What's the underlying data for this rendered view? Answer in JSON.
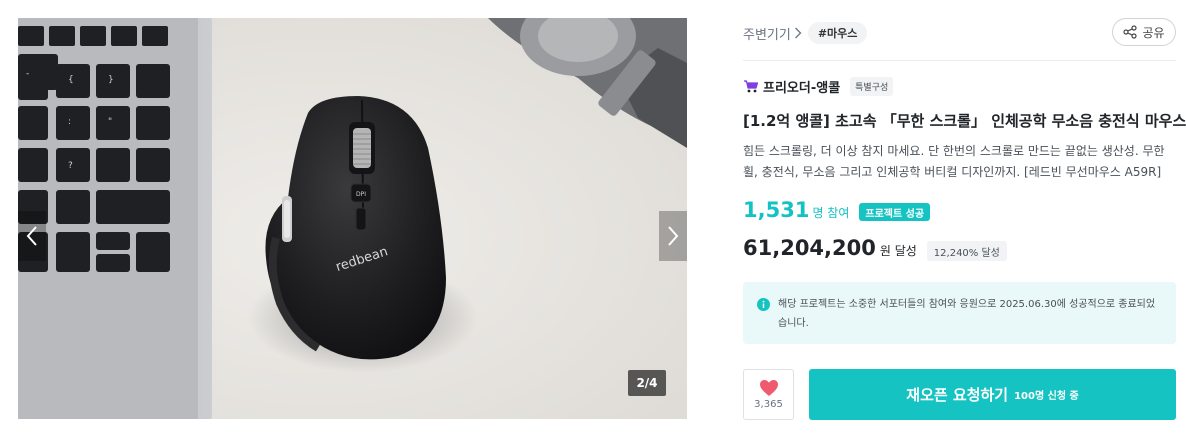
{
  "gallery": {
    "pager": "2/4",
    "brand_print": "redbean"
  },
  "breadcrumb": {
    "category": "주변기기",
    "tag": "#마우스"
  },
  "share": {
    "label": "공유"
  },
  "maker": {
    "name": "프리오더-앵콜",
    "badge": "특별구성"
  },
  "product": {
    "title": "[1.2억 앵콜] 초고속 「무한 스크롤」 인체공학 무소음 충전식 마우스",
    "description": "힘든 스크롤링, 더 이상 참지 마세요. 단 한번의 스크롤로 만드는 끝없는 생산성. 무한휠, 충전식, 무소음 그리고 인체공학 버티컬 디자인까지. [레드빈 무선마우스 A59R]"
  },
  "stats": {
    "participants": "1,531",
    "participants_unit": "명 참여",
    "success_tag": "프로젝트 성공",
    "amount": "61,204,200",
    "amount_unit": "원 달성",
    "rate": "12,240% 달성"
  },
  "notice": {
    "text": "해당 프로젝트는 소중한 서포터들의 참여와 응원으로 2025.06.30에 성공적으로 종료되었습니다."
  },
  "actions": {
    "like_count": "3,365",
    "cta_label": "재오픈 요청하기",
    "cta_sub": "100명 신청 중"
  },
  "colors": {
    "accent": "#15c3c3",
    "like": "#ef5a6f"
  },
  "icons": {
    "prev": "chevron-left-icon",
    "next": "chevron-right-icon",
    "share": "share-icon",
    "maker": "maker-cart-icon",
    "info": "info-icon",
    "like": "heart-icon"
  }
}
